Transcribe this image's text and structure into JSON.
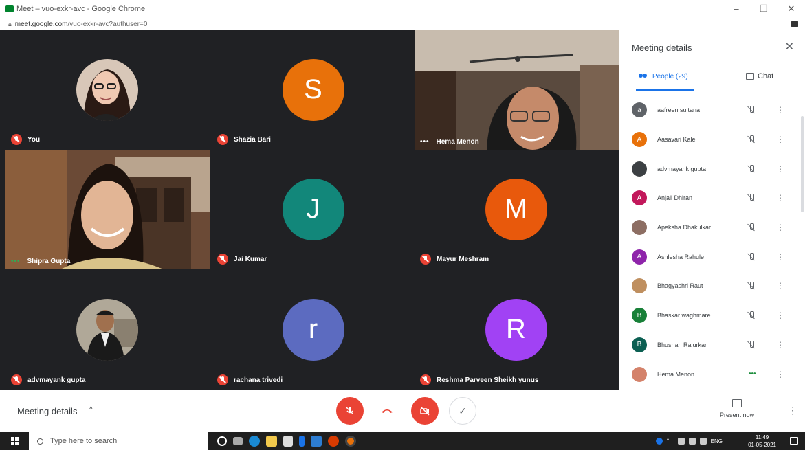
{
  "browser": {
    "window_title": "Meet – vuo-exkr-avc - Google Chrome",
    "url_host": "meet.google.com",
    "url_path": "/vuo-exkr-avc?authuser=0"
  },
  "tiles": [
    {
      "name": "You",
      "initial": "",
      "color": "",
      "type": "photo",
      "status": "muted"
    },
    {
      "name": "Shazia Bari",
      "initial": "S",
      "color": "#e8710a",
      "type": "initial",
      "status": "muted"
    },
    {
      "name": "Hema Menon",
      "initial": "",
      "color": "",
      "type": "video",
      "status": "talking"
    },
    {
      "name": "Shipra Gupta",
      "initial": "",
      "color": "",
      "type": "video",
      "status": "talking"
    },
    {
      "name": "Jai Kumar",
      "initial": "J",
      "color": "#12877a",
      "type": "initial",
      "status": "muted"
    },
    {
      "name": "Mayur Meshram",
      "initial": "M",
      "color": "#e8590c",
      "type": "initial",
      "status": "muted"
    },
    {
      "name": "advmayank gupta",
      "initial": "",
      "color": "",
      "type": "photo",
      "status": "muted"
    },
    {
      "name": "rachana trivedi",
      "initial": "r",
      "color": "#5c6bc0",
      "type": "initial",
      "status": "muted"
    },
    {
      "name": "Reshma Parveen Sheikh yunus",
      "initial": "R",
      "color": "#a142f4",
      "type": "initial",
      "status": "muted"
    }
  ],
  "panel": {
    "title": "Meeting details",
    "close_icon": "close-icon",
    "tab_people": "People (29)",
    "tab_chat": "Chat",
    "people": [
      {
        "name": "aafreen sultana",
        "initial": "a",
        "color": "#5f6368",
        "status": "muted"
      },
      {
        "name": "Aasavari Kale",
        "initial": "A",
        "color": "#e8710a",
        "status": "muted"
      },
      {
        "name": "advmayank gupta",
        "initial": "",
        "color": "#3c4043",
        "status": "muted"
      },
      {
        "name": "Anjali Dhiran",
        "initial": "A",
        "color": "#c2185b",
        "status": "muted"
      },
      {
        "name": "Apeksha Dhakulkar",
        "initial": "",
        "color": "#8d6e63",
        "status": "muted"
      },
      {
        "name": "Ashlesha Rahule",
        "initial": "A",
        "color": "#8e24aa",
        "status": "muted"
      },
      {
        "name": "Bhagyashri Raut",
        "initial": "",
        "color": "#bf8f5f",
        "status": "muted"
      },
      {
        "name": "Bhaskar waghmare",
        "initial": "B",
        "color": "#188038",
        "status": "muted"
      },
      {
        "name": "Bhushan Rajurkar",
        "initial": "B",
        "color": "#0b5f52",
        "status": "muted"
      },
      {
        "name": "Hema Menon",
        "initial": "",
        "color": "#d4826a",
        "status": "talking"
      }
    ]
  },
  "bottombar": {
    "meeting_details": "Meeting details",
    "caret": "^",
    "present_now": "Present now"
  },
  "taskbar": {
    "search_placeholder": "Type here to search",
    "language": "ENG",
    "time": "11:49",
    "date": "01-05-2021"
  },
  "colors": {
    "accent_blue": "#1a73e8",
    "end_call_red": "#ea4335",
    "grid_bg": "#202124"
  }
}
